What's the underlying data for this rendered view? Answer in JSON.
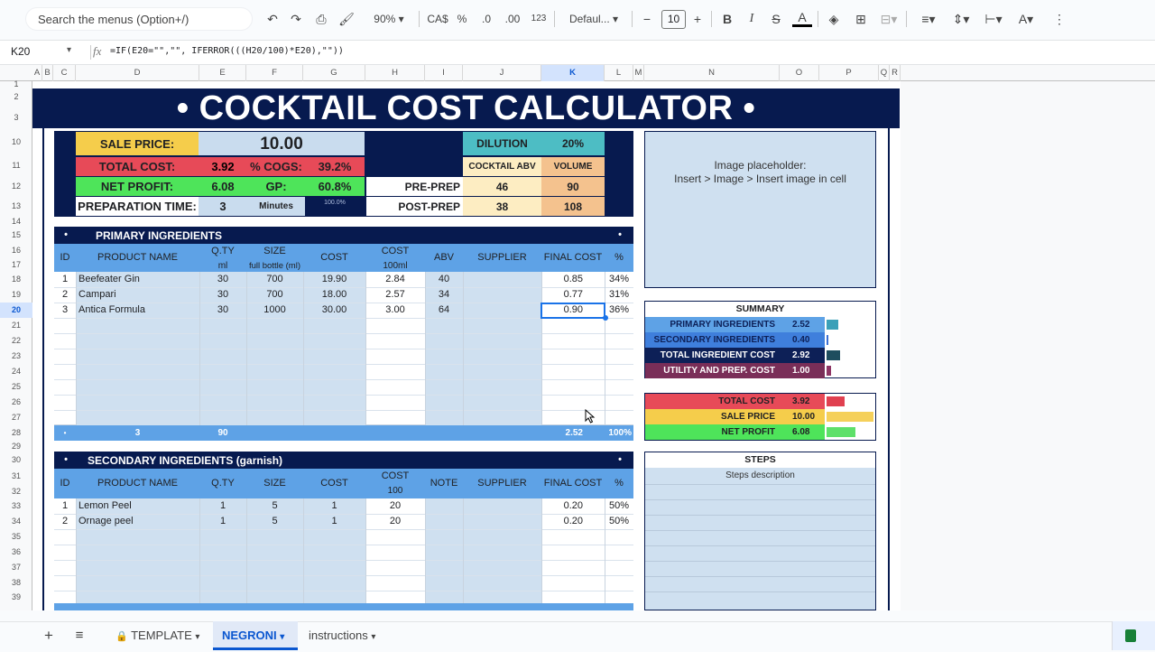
{
  "toolbar": {
    "search_placeholder": "Search the menus (Option+/)",
    "zoom": "90%",
    "currency": "CA$",
    "percent": "%",
    "dec_decrease": ".0",
    "dec_increase": ".00",
    "number_format": "123",
    "font": "Defaul...",
    "font_size": "10",
    "bold": "B",
    "italic": "I",
    "text_color": "A"
  },
  "formula_bar": {
    "cell_ref": "K20",
    "fx": "fx",
    "formula": "=IF(E20=\"\",\"\", IFERROR(((H20/100)*E20),\"\"))"
  },
  "columns": [
    "A",
    "B",
    "C",
    "D",
    "E",
    "F",
    "G",
    "H",
    "I",
    "J",
    "K",
    "L",
    "M",
    "N",
    "O",
    "P",
    "Q",
    "R"
  ],
  "rows": [
    "1",
    "2",
    "3",
    "10",
    "11",
    "12",
    "13",
    "14",
    "15",
    "16",
    "17",
    "18",
    "19",
    "20",
    "21",
    "22",
    "23",
    "24",
    "25",
    "26",
    "27",
    "28",
    "29",
    "30",
    "31",
    "32",
    "33",
    "34",
    "35",
    "36",
    "37",
    "38",
    "39"
  ],
  "banner": "• COCKTAIL COST CALCULATOR •",
  "top": {
    "sale_price_label": "SALE PRICE:",
    "sale_price": "10.00",
    "total_cost_label": "TOTAL COST:",
    "total_cost": "3.92",
    "cogs_label": "% COGS:",
    "cogs": "39.2%",
    "net_profit_label": "NET PROFIT:",
    "net_profit": "6.08",
    "gp_label": "GP:",
    "gp": "60.8%",
    "prep_label": "PREPARATION TIME:",
    "prep_value": "3",
    "prep_unit": "Minutes",
    "hundred": "100.0%",
    "dilution_label": "DILUTION",
    "dilution": "20%",
    "abv_label": "COCKTAIL ABV",
    "volume_label": "VOLUME",
    "preprep_label": "PRE-PREP",
    "preprep_abv": "46",
    "preprep_vol": "90",
    "postprep_label": "POST-PREP",
    "postprep_abv": "38",
    "postprep_vol": "108"
  },
  "primary": {
    "title": "PRIMARY INGREDIENTS",
    "bullet": "•",
    "headers": {
      "id": "ID",
      "name": "PRODUCT NAME",
      "qty": "Q.TY",
      "qty_unit": "ml",
      "size": "SIZE",
      "size_unit": "full bottle (ml)",
      "cost": "COST",
      "cost100": "COST",
      "cost100_unit": "100ml",
      "abv": "ABV",
      "supplier": "SUPPLIER",
      "final": "FINAL COST",
      "pct": "%"
    },
    "rows": [
      {
        "id": "1",
        "name": "Beefeater Gin",
        "qty": "30",
        "size": "700",
        "cost": "19.90",
        "cost100": "2.84",
        "abv": "40",
        "final": "0.85",
        "pct": "34%"
      },
      {
        "id": "2",
        "name": "Campari",
        "qty": "30",
        "size": "700",
        "cost": "18.00",
        "cost100": "2.57",
        "abv": "34",
        "final": "0.77",
        "pct": "31%"
      },
      {
        "id": "3",
        "name": "Antica Formula",
        "qty": "30",
        "size": "1000",
        "cost": "30.00",
        "cost100": "3.00",
        "abv": "64",
        "final": "0.90",
        "pct": "36%"
      }
    ],
    "total": {
      "count": "3",
      "qty": "90",
      "final": "2.52",
      "pct": "100%"
    }
  },
  "secondary": {
    "title": "SECONDARY INGREDIENTS (garnish)",
    "bullet": "•",
    "headers": {
      "id": "ID",
      "name": "PRODUCT NAME",
      "qty": "Q.TY",
      "size": "SIZE",
      "cost": "COST",
      "cost100": "COST",
      "cost100_unit": "100",
      "note": "NOTE",
      "supplier": "SUPPLIER",
      "final": "FINAL COST",
      "pct": "%"
    },
    "rows": [
      {
        "id": "1",
        "name": "Lemon Peel",
        "qty": "1",
        "size": "5",
        "cost": "1",
        "cost100": "20",
        "final": "0.20",
        "pct": "50%"
      },
      {
        "id": "2",
        "name": "Ornage peel",
        "qty": "1",
        "size": "5",
        "cost": "1",
        "cost100": "20",
        "final": "0.20",
        "pct": "50%"
      }
    ]
  },
  "image_box": {
    "line1": "Image placeholder:",
    "line2": "Insert > Image > Insert image in cell"
  },
  "summary": {
    "title": "SUMMARY",
    "items": [
      {
        "label": "PRIMARY INGREDIENTS",
        "value": "2.52",
        "bar": 0.252,
        "bar_color": "#3aa0b8"
      },
      {
        "label": "SECONDARY INGREDIENTS",
        "value": "0.40",
        "bar": 0.04,
        "bar_color": "#3b6fd4"
      },
      {
        "label": "TOTAL INGREDIENT COST",
        "value": "2.92",
        "bar": 0.292,
        "bar_color": "#1e4d5e"
      },
      {
        "label": "UTILITY AND PREP. COST",
        "value": "1.00",
        "bar": 0.1,
        "bar_color": "#8e3464"
      }
    ],
    "totals": [
      {
        "label": "TOTAL COST",
        "value": "3.92",
        "bar": 0.392,
        "bar_color": "#e04050"
      },
      {
        "label": "SALE PRICE",
        "value": "10.00",
        "bar": 1.0,
        "bar_color": "#f5d05a"
      },
      {
        "label": "NET PROFIT",
        "value": "6.08",
        "bar": 0.608,
        "bar_color": "#5ee06a"
      }
    ]
  },
  "steps": {
    "title": "STEPS",
    "description": "Steps description"
  },
  "tabs": {
    "template": "TEMPLATE",
    "negroni": "NEGRONI",
    "instructions": "instructions"
  }
}
